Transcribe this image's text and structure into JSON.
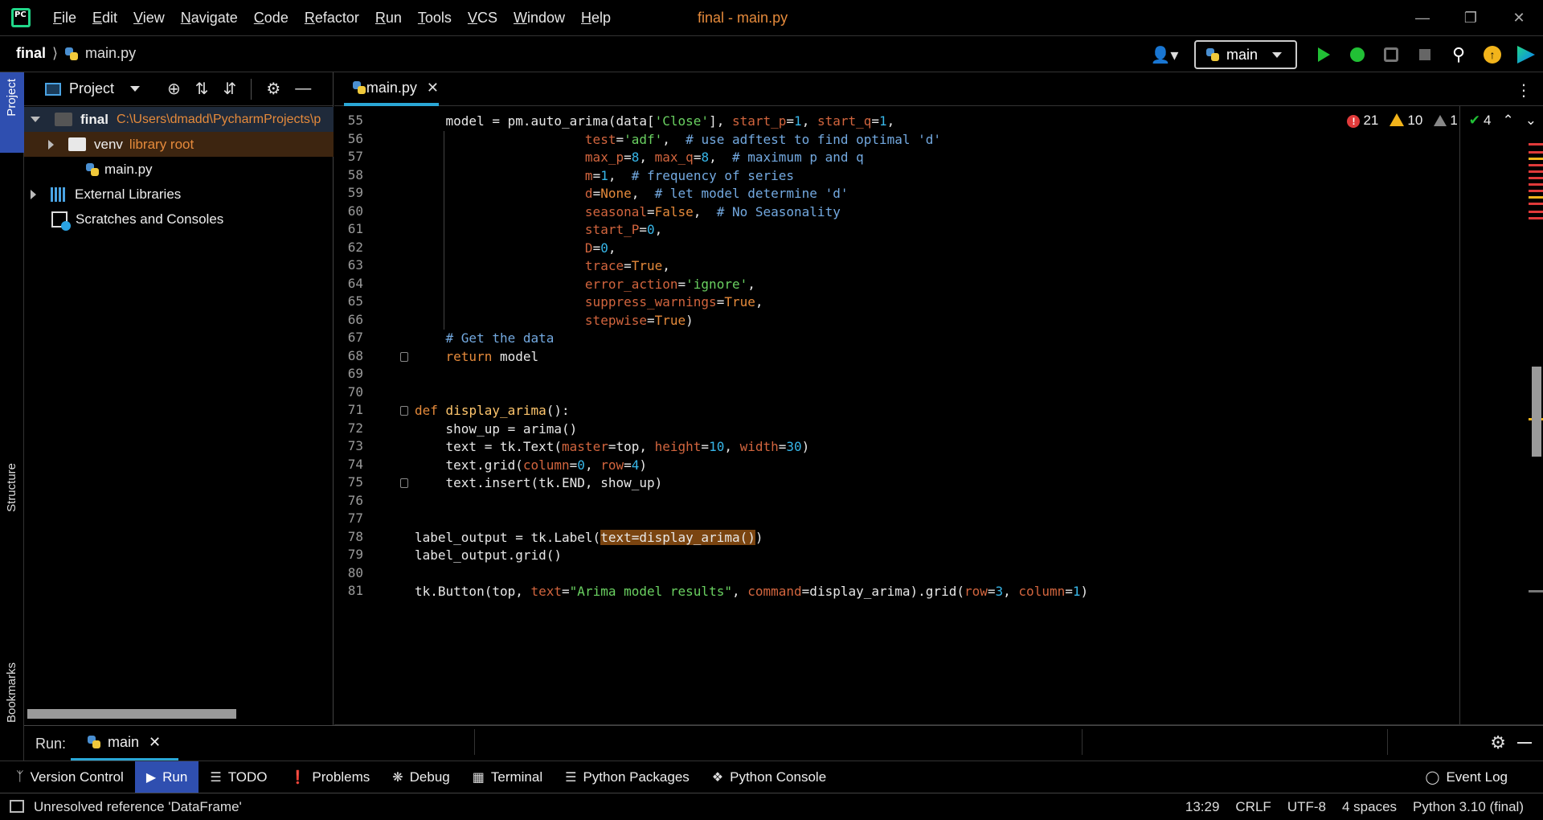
{
  "app": {
    "logo": "PC",
    "window_title": "final - main.py"
  },
  "menu": [
    "File",
    "Edit",
    "View",
    "Navigate",
    "Code",
    "Refactor",
    "Run",
    "Tools",
    "VCS",
    "Window",
    "Help"
  ],
  "menu_mnemonics": [
    "F",
    "E",
    "V",
    "N",
    "C",
    "R",
    "R",
    "T",
    "V",
    "W",
    "H"
  ],
  "breadcrumb": {
    "project": "final",
    "file": "main.py"
  },
  "run_config": {
    "name": "main"
  },
  "left_stripe": {
    "project": "Project",
    "structure": "Structure",
    "bookmarks": "Bookmarks"
  },
  "project_panel": {
    "title": "Project",
    "tree": [
      {
        "name": "final",
        "path": "C:\\Users\\dmadd\\PycharmProjects\\p"
      },
      {
        "name": "venv",
        "tag": "library root"
      },
      {
        "name": "main.py"
      },
      {
        "name": "External Libraries"
      },
      {
        "name": "Scratches and Consoles"
      }
    ]
  },
  "editor": {
    "tab": "main.py",
    "inspections": {
      "errors": "21",
      "warnings": "10",
      "weak_warnings": "1",
      "ok": "4"
    },
    "first_line": 55,
    "line_numbers": [
      "55",
      "56",
      "57",
      "58",
      "59",
      "60",
      "61",
      "62",
      "63",
      "64",
      "65",
      "66",
      "67",
      "68",
      "69",
      "70",
      "71",
      "72",
      "73",
      "74",
      "75",
      "76",
      "77",
      "78",
      "79",
      "80",
      "81"
    ]
  },
  "code": {
    "l55": [
      "    model = pm.auto_arima(data[",
      "'Close'",
      "], ",
      "start_p",
      "=",
      "1",
      ", ",
      "start_q",
      "=",
      "1",
      ","
    ],
    "l56": [
      "                      ",
      "test",
      "=",
      "'adf'",
      ",  ",
      "# use adftest to find optimal 'd'"
    ],
    "l57": [
      "                      ",
      "max_p",
      "=",
      "8",
      ", ",
      "max_q",
      "=",
      "8",
      ",  ",
      "# maximum p and q"
    ],
    "l58": [
      "                      ",
      "m",
      "=",
      "1",
      ",  ",
      "# frequency of series"
    ],
    "l59": [
      "                      ",
      "d",
      "=",
      "None",
      ",  ",
      "# let model determine 'd'"
    ],
    "l60": [
      "                      ",
      "seasonal",
      "=",
      "False",
      ",  ",
      "# No Seasonality"
    ],
    "l61": [
      "                      ",
      "start_P",
      "=",
      "0",
      ","
    ],
    "l62": [
      "                      ",
      "D",
      "=",
      "0",
      ","
    ],
    "l63": [
      "                      ",
      "trace",
      "=",
      "True",
      ","
    ],
    "l64": [
      "                      ",
      "error_action",
      "=",
      "'ignore'",
      ","
    ],
    "l65": [
      "                      ",
      "suppress_warnings",
      "=",
      "True",
      ","
    ],
    "l66": [
      "                      ",
      "stepwise",
      "=",
      "True",
      ")"
    ],
    "l67": [
      "    ",
      "# Get the data"
    ],
    "l68": [
      "    ",
      "return",
      " model"
    ],
    "l71": [
      "def",
      " ",
      "display_arima",
      "():"
    ],
    "l72": [
      "    show_up = arima()"
    ],
    "l73": [
      "    text = tk.Text(",
      "master",
      "=top, ",
      "height",
      "=",
      "10",
      ", ",
      "width",
      "=",
      "30",
      ")"
    ],
    "l74": [
      "    text.grid(",
      "column",
      "=",
      "0",
      ", ",
      "row",
      "=",
      "4",
      ")"
    ],
    "l75": [
      "    text.insert(tk.END, show_up)"
    ],
    "l78": [
      "label_output = tk.Label(",
      "text=display_arima()",
      ")"
    ],
    "l79": [
      "label_output.grid()"
    ],
    "l81": [
      "tk.Button(top, ",
      "text",
      "=",
      "\"Arima model results\"",
      ", ",
      "command",
      "=display_arima).grid(",
      "row",
      "=",
      "3",
      ", ",
      "column",
      "=",
      "1",
      ")"
    ]
  },
  "run_panel": {
    "label": "Run:",
    "tab": "main"
  },
  "tool_windows": [
    "Version Control",
    "Run",
    "TODO",
    "Problems",
    "Debug",
    "Terminal",
    "Python Packages",
    "Python Console"
  ],
  "event_log": "Event Log",
  "status": {
    "message": "Unresolved reference 'DataFrame'",
    "position": "13:29",
    "line_sep": "CRLF",
    "encoding": "UTF-8",
    "indent": "4 spaces",
    "interpreter": "Python 3.10 (final)"
  },
  "colors": {
    "accent": "#2f4fb0",
    "tab_underline": "#2aa7d6",
    "keyword": "#e58a3b",
    "string": "#6ad161",
    "number": "#37b6e8",
    "comment": "#73a9e0"
  }
}
